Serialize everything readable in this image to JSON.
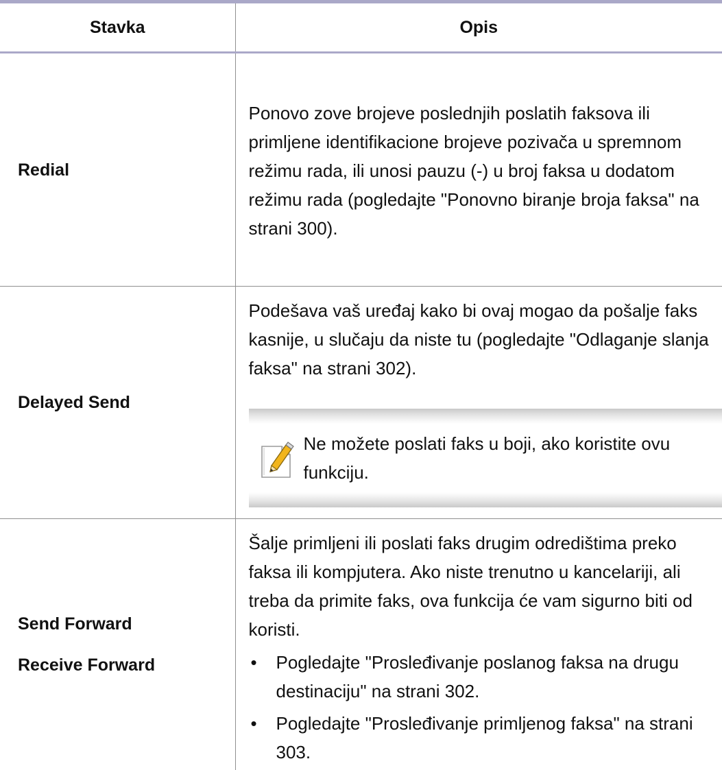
{
  "table": {
    "headers": {
      "item": "Stavka",
      "description": "Opis"
    },
    "rows": {
      "redial": {
        "item": "Redial",
        "description": "Ponovo zove brojeve poslednjih poslatih faksova ili primljene identifikacione brojeve pozivača u spremnom režimu rada, ili unosi pauzu (-) u broj faksa u dodatom režimu rada (pogledajte \"Ponovno biranje broja faksa\" na strani 300)."
      },
      "delayed_send": {
        "item": "Delayed Send",
        "description": "Podešava vaš uređaj kako bi ovaj mogao da pošalje faks kasnije, u slučaju da niste tu (pogledajte \"Odlaganje slanja faksa\" na strani 302).",
        "note": "Ne možete poslati faks u boji, ako koristite ovu funkciju.",
        "note_icon": "note-pencil-icon"
      },
      "forward": {
        "items": [
          "Send Forward",
          "Receive Forward"
        ],
        "description": "Šalje primljeni ili poslati faks drugim odredištima preko faksa ili kompjutera. Ako niste trenutno u kancelariji, ali treba da primite faks, ova funkcija će vam sigurno biti od koristi.",
        "bullets": [
          "Pogledajte \"Prosleđivanje poslanog faksa na drugu destinaciju\" na strani 302.",
          "Pogledajte \"Prosleđivanje primljenog faksa\" na strani 303."
        ]
      }
    }
  },
  "colors": {
    "header_rule": "#aaa8c8",
    "cell_border": "#8f8f8f",
    "note_band": "#c9c9c9",
    "icon_accent": "#f2b51c"
  }
}
